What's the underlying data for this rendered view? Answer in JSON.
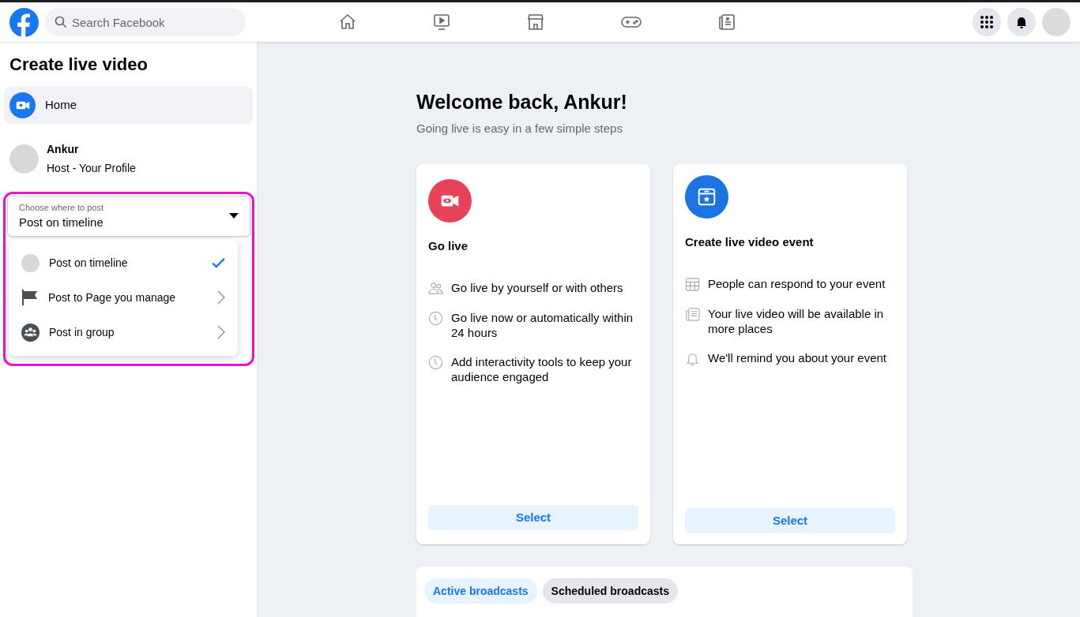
{
  "topbar": {
    "search": {
      "placeholder": "Search Facebook"
    }
  },
  "sidebar": {
    "title": "Create live video",
    "nav": [
      {
        "label": "Home",
        "selected": true
      }
    ],
    "host": {
      "name": "Ankur",
      "role": "Host - Your Profile"
    },
    "post_select": {
      "label": "Choose where to post",
      "value": "Post on timeline",
      "options": [
        {
          "label": "Post on timeline",
          "kind": "avatar",
          "selected": true,
          "submenu": false
        },
        {
          "label": "Post to Page you manage",
          "kind": "flag",
          "selected": false,
          "submenu": true
        },
        {
          "label": "Post in group",
          "kind": "group",
          "selected": false,
          "submenu": true
        }
      ]
    }
  },
  "main": {
    "title": "Welcome back, Ankur!",
    "subtitle": "Going live is easy in a few simple steps",
    "cards": [
      {
        "kind": "live",
        "title": "Go live",
        "button": "Select",
        "features": [
          {
            "kind": "people",
            "text": "Go live by yourself or with others"
          },
          {
            "kind": "clock",
            "text": "Go live now or automatically within 24 hours"
          },
          {
            "kind": "clock",
            "text": "Add interactivity tools to keep your audience engaged"
          }
        ]
      },
      {
        "kind": "event",
        "title": "Create live video event",
        "button": "Select",
        "features": [
          {
            "kind": "calendar",
            "text": "People can respond to your event"
          },
          {
            "kind": "news",
            "text": "Your live video will be available in more places"
          },
          {
            "kind": "bell",
            "text": "We'll remind you about your event"
          }
        ]
      }
    ],
    "tabs": [
      {
        "label": "Active broadcasts",
        "selected": true
      },
      {
        "label": "Scheduled broadcasts",
        "selected": false
      }
    ]
  }
}
